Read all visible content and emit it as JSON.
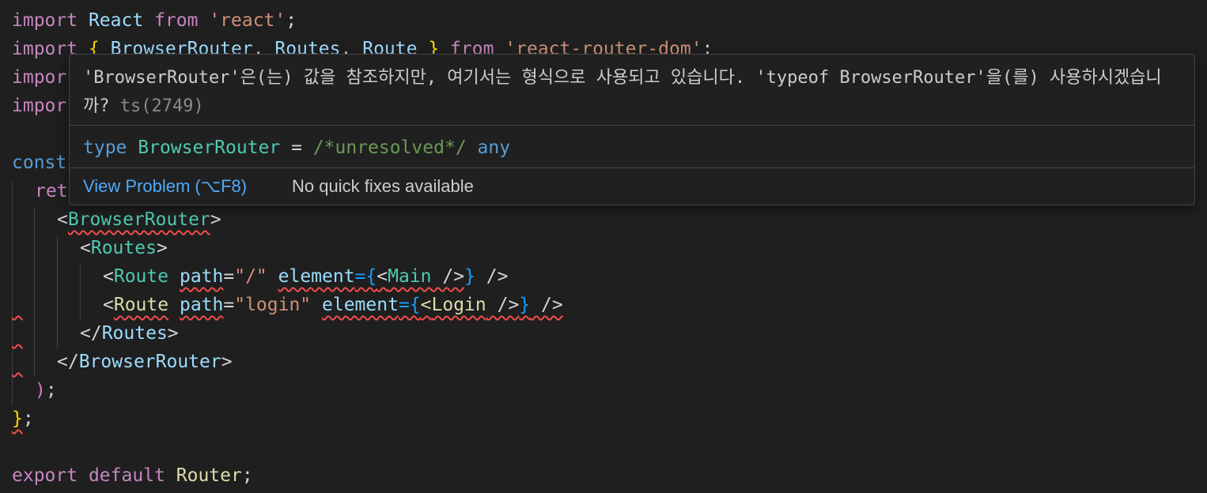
{
  "code": {
    "l1": {
      "import": "import",
      "react": "React",
      "from": "from",
      "mod": "'react'",
      "semi": ";"
    },
    "l2": {
      "import": "import",
      "open": "{",
      "a": "BrowserRouter",
      "c1": ",",
      "b": "Routes",
      "c2": ",",
      "c": "Route",
      "close": "}",
      "from": "from",
      "mod": "'react-router-dom'",
      "semi": ";"
    },
    "l3": {
      "import": "impor"
    },
    "l4": {
      "import": "impor"
    },
    "l6": {
      "const": "const"
    },
    "l7": {
      "ret": "ret"
    },
    "l8": {
      "lt": "<",
      "tag": "BrowserRouter",
      "gt": ">"
    },
    "l9": {
      "lt": "<",
      "tag": "Routes",
      "gt": ">"
    },
    "l10": {
      "lt": "<",
      "tag": "Route",
      "attr1": "path",
      "eq1": "=",
      "val1": "\"/\"",
      "attr2": "element",
      "eq2": "={",
      "lt2": "<",
      "comp": "Main",
      "sl": " />",
      "cb": "}",
      "end": " />"
    },
    "l11": {
      "lt": "<",
      "tag": "Route",
      "attr1": "path",
      "eq1": "=",
      "val1": "\"login\"",
      "attr2": "element",
      "eq2": "={",
      "lt2": "<",
      "comp": "Login",
      "sl": " />",
      "cb": "}",
      "end": " />"
    },
    "l12": {
      "lt": "</",
      "tag": "Routes",
      "gt": ">"
    },
    "l13": {
      "lt": "</",
      "tag": "BrowserRouter",
      "gt": ">"
    },
    "l14": {
      "paren": ")",
      "semi": ";"
    },
    "l15": {
      "brace": "}",
      "semi": ";"
    },
    "l17": {
      "export": "export",
      "default": "default",
      "name": "Router",
      "semi": ";"
    }
  },
  "hover": {
    "message": "'BrowserRouter'은(는) 값을 참조하지만, 여기서는 형식으로 사용되고 있습니다. 'typeof BrowserRouter'을(를) 사용하시겠습니까?",
    "code": "ts(2749)",
    "type_kw": "type",
    "type_name": "BrowserRouter",
    "eq": " = ",
    "comment": "/*unresolved*/",
    "any": " any",
    "view_problem": "View Problem (⌥F8)",
    "no_fixes": "No quick fixes available"
  },
  "colors": {
    "background": "#1f1f1f",
    "error_squiggle": "#f14c4c",
    "link": "#4daafc"
  }
}
